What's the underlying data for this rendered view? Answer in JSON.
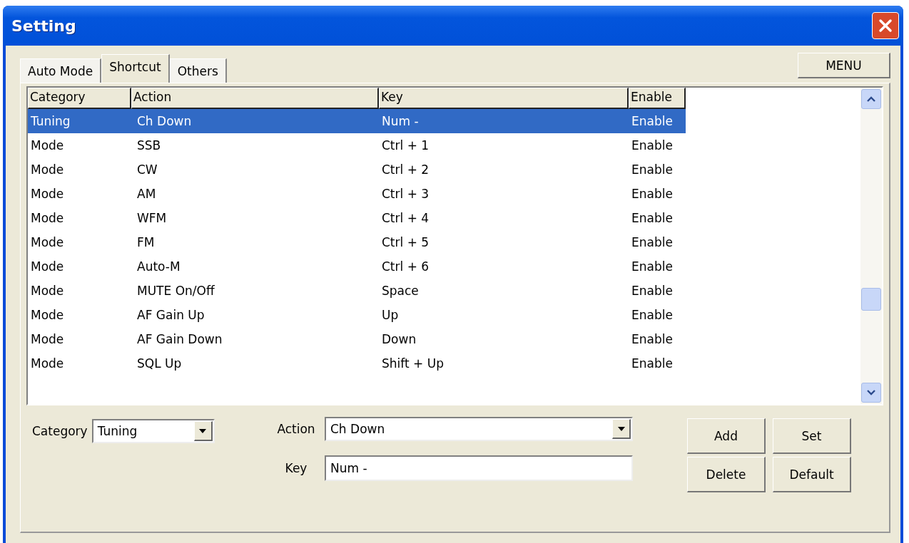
{
  "window": {
    "title": "Setting"
  },
  "menu_button": "MENU",
  "tabs": [
    {
      "label": "Auto Mode",
      "selected": false
    },
    {
      "label": "Shortcut",
      "selected": true
    },
    {
      "label": "Others",
      "selected": false
    }
  ],
  "table": {
    "columns": [
      "Category",
      "Action",
      "Key",
      "Enable"
    ],
    "rows": [
      {
        "cells": [
          "Tuning",
          "Ch Down",
          "Num -",
          "Enable"
        ],
        "selected": true
      },
      {
        "cells": [
          "Mode",
          "SSB",
          "Ctrl + 1",
          "Enable"
        ],
        "selected": false
      },
      {
        "cells": [
          "Mode",
          "CW",
          "Ctrl + 2",
          "Enable"
        ],
        "selected": false
      },
      {
        "cells": [
          "Mode",
          "AM",
          "Ctrl + 3",
          "Enable"
        ],
        "selected": false
      },
      {
        "cells": [
          "Mode",
          "WFM",
          "Ctrl + 4",
          "Enable"
        ],
        "selected": false
      },
      {
        "cells": [
          "Mode",
          "FM",
          "Ctrl + 5",
          "Enable"
        ],
        "selected": false
      },
      {
        "cells": [
          "Mode",
          "Auto-M",
          "Ctrl + 6",
          "Enable"
        ],
        "selected": false
      },
      {
        "cells": [
          "Mode",
          "MUTE On/Off",
          "Space",
          "Enable"
        ],
        "selected": false
      },
      {
        "cells": [
          "Mode",
          "AF Gain Up",
          "Up",
          "Enable"
        ],
        "selected": false
      },
      {
        "cells": [
          "Mode",
          "AF Gain Down",
          "Down",
          "Enable"
        ],
        "selected": false
      },
      {
        "cells": [
          "Mode",
          "SQL Up",
          "Shift + Up",
          "Enable"
        ],
        "selected": false
      }
    ]
  },
  "editor": {
    "category_label": "Category",
    "category_value": "Tuning",
    "action_label": "Action",
    "action_value": "Ch Down",
    "key_label": "Key",
    "key_value": "Num -"
  },
  "buttons": [
    "Add",
    "Set",
    "Delete",
    "Default"
  ]
}
